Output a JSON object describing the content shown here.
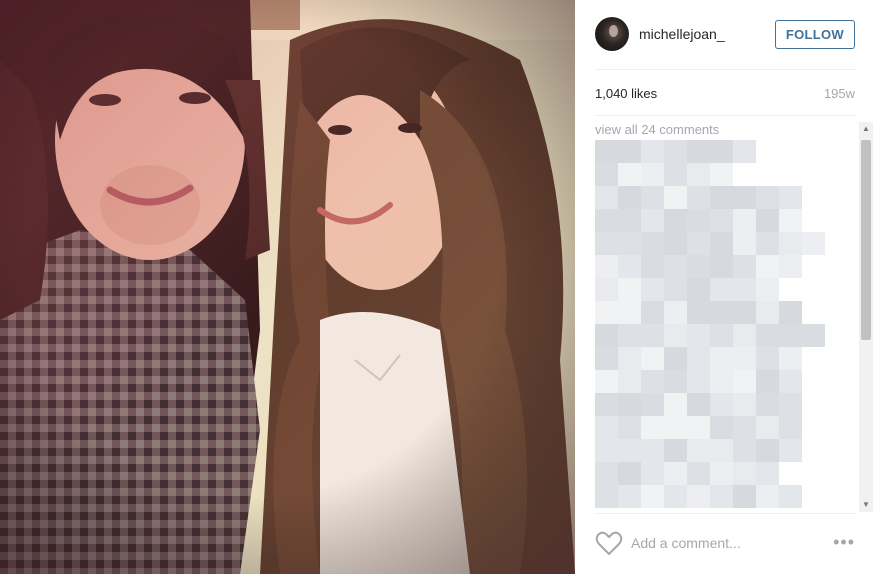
{
  "post": {
    "username": "michellejoan_",
    "follow_label": "FOLLOW",
    "likes": "1,040 likes",
    "age": "195w",
    "view_all_comments": "view all 24 comments",
    "comment_placeholder": "Add a comment...",
    "more_label": "•••"
  },
  "scrollbar": {
    "up_arrow": "▲",
    "down_arrow": "▼"
  },
  "icons": {
    "avatar": "profile-photo",
    "like": "heart-outline-icon",
    "more": "ellipsis-icon"
  },
  "colors": {
    "follow": "#3f729b",
    "muted_text": "#a5a7aa",
    "text": "#262626",
    "divider": "#efefef"
  }
}
